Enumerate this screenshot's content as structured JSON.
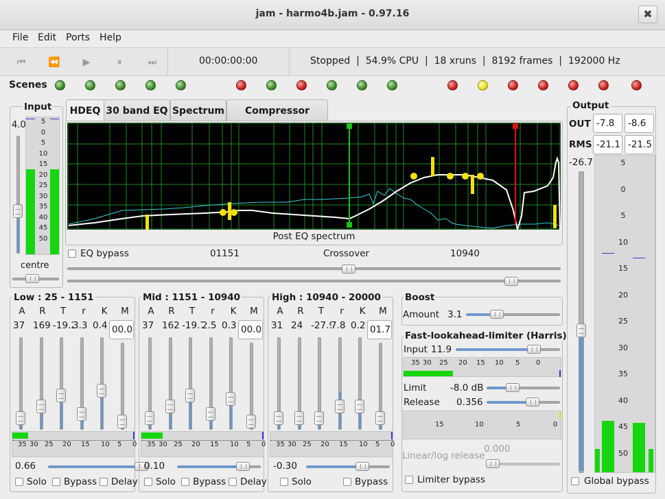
{
  "window": {
    "title": "jam - harmo4b.jam - 0.97.16",
    "close": "✖"
  },
  "menu": [
    "File",
    "Edit",
    "Ports",
    "Help"
  ],
  "toolbar": {
    "rewind_start": "⏮",
    "rewind": "⏪",
    "play": "▶",
    "pause": "⏸",
    "ffwd_end": "⏭",
    "time": "00:00:00:00",
    "status": "Stopped  |  54.9% CPU  |  18 xruns  |  8192 frames  |  192000 Hz"
  },
  "scenes": {
    "label": "Scenes",
    "leds": [
      "green",
      "green",
      "green",
      "green",
      "green",
      "red",
      "green",
      "red",
      "green",
      "green",
      "green",
      "red",
      "yellow",
      "red",
      "red",
      "red",
      "red",
      "red"
    ]
  },
  "input": {
    "title": "Input",
    "value": "4.0",
    "balance_label": "centre",
    "scale": [
      "5",
      "0",
      "5",
      "10",
      "15",
      "20",
      "25",
      "30",
      "35",
      "40",
      "45",
      "50"
    ],
    "level_left": 0.62,
    "level_right": 0.62
  },
  "tabs": [
    "HDEQ",
    "30 band EQ",
    "Spectrum",
    "Compressor curves"
  ],
  "graph": {
    "caption": "Post EQ spectrum"
  },
  "eq": {
    "bypass_label": "EQ bypass",
    "low_value": "01151",
    "crossover_label": "Crossover",
    "high_value": "10940",
    "slider1_pos": 0.57,
    "slider2_pos": 0.9
  },
  "bands": [
    {
      "title": "Low : 25 - 1151",
      "headers": [
        "A",
        "R",
        "T",
        "r",
        "K",
        "M"
      ],
      "values": [
        "37",
        "169",
        "-19.2",
        "3.3",
        "0.4"
      ],
      "makeup": "00.0",
      "meter_scale": [
        "35",
        "30",
        "25",
        "20",
        "15",
        "10",
        "5",
        "0"
      ],
      "gain": "0.66",
      "solo": "Solo",
      "bypass": "Bypass",
      "delay": "Delay",
      "level": 0.13
    },
    {
      "title": "Mid : 1151 - 10940",
      "headers": [
        "A",
        "R",
        "T",
        "r",
        "K",
        "M"
      ],
      "values": [
        "37",
        "162",
        "-19.7",
        "2.5",
        "0.3"
      ],
      "makeup": "00.0",
      "meter_scale": [
        "35",
        "30",
        "25",
        "20",
        "15",
        "10",
        "5",
        "0"
      ],
      "gain": "0.10",
      "solo": "Solo",
      "bypass": "Bypass",
      "delay": "Delay",
      "level": 0.17
    },
    {
      "title": "High : 10940 - 20000",
      "headers": [
        "A",
        "R",
        "T",
        "r",
        "K",
        "M"
      ],
      "values": [
        "31",
        "24",
        "-27.9",
        "7.8",
        "0.2"
      ],
      "makeup": "01.7",
      "meter_scale": [
        "35",
        "30",
        "25",
        "20",
        "15",
        "10",
        "5",
        "0"
      ],
      "gain": "-0.30",
      "solo": "Solo",
      "bypass": "Bypass",
      "delay": "",
      "level": 0.0
    }
  ],
  "boost": {
    "title": "Boost",
    "amount_label": "Amount",
    "amount": "3.1"
  },
  "limiter": {
    "title": "Fast-lookahead-limiter (Harris)",
    "input_label": "Input",
    "input": "11.9",
    "meter_scale": [
      "35",
      "30",
      "25",
      "20",
      "15",
      "10",
      "5",
      "0"
    ],
    "limit_label": "Limit",
    "limit": "-8.0 dB",
    "release_label": "Release",
    "release": "0.356",
    "gr_scale": [
      "15",
      "10",
      "5",
      "0"
    ],
    "linlog_label": "Linear/log release",
    "linlog": "0.000",
    "bypass_label": "Limiter bypass",
    "input_level": 0.31
  },
  "output": {
    "title": "Output",
    "out_label": "OUT",
    "out_l": "-7.8",
    "out_r": "-8.6",
    "rms_label": "RMS",
    "rms_l": "-21.1",
    "rms_r": "-21.5",
    "gain": "-26.7",
    "scale": [
      "5",
      "0",
      "5",
      "10",
      "15",
      "20",
      "25",
      "30",
      "35",
      "40",
      "45",
      "50"
    ],
    "global_bypass": "Global bypass"
  }
}
